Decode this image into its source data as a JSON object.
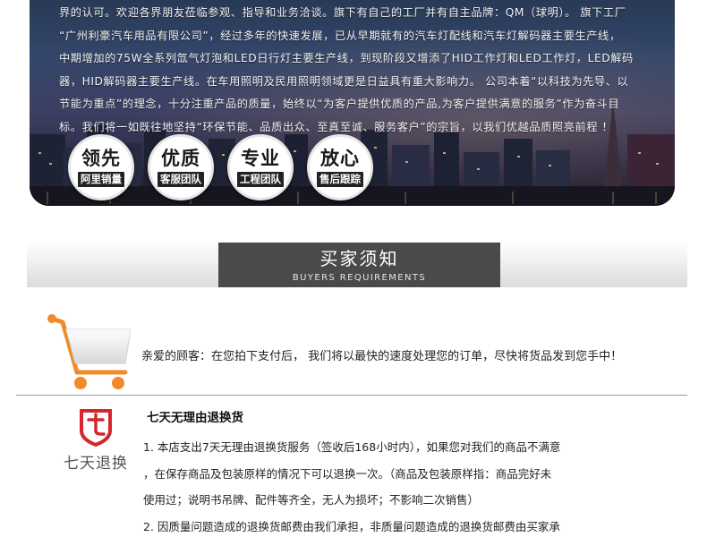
{
  "intro": {
    "lines": [
      "界的认可。欢迎各界朋友莅临参观、指导和业务洽谈。旗下有自己的工厂并有自主品牌：QM（球明）。 旗下工厂",
      "“广州利豪汽车用品有限公司”，经过多年的快速发展，已从早期就有的汽车灯配线和汽车灯解码器主要生产线，",
      "中期增加的75W全系列氙气灯泡和LED日行灯主要生产线，到现阶段又增添了HID工作灯和LED工作灯，LED解码",
      "器，HID解码器主要生产线。在车用照明及民用照明领域更是日益具有重大影响力。 公司本着“以科技为先导、以",
      "节能为重点”的理念，十分注重产品的质量，始终以“为客户提供优质的产品,为客户提供满意的服务”作为奋斗目",
      "标。我们将一如既往地坚持“环保节能、品质出众、至真至诚、服务客户”的宗旨，以我们优越品质照亮前程 ！"
    ],
    "badges": [
      {
        "top": "领先",
        "sub": "阿里销量"
      },
      {
        "top": "优质",
        "sub": "客服团队"
      },
      {
        "top": "专业",
        "sub": "工程团队"
      },
      {
        "top": "放心",
        "sub": "售后跟踪"
      }
    ]
  },
  "requirements": {
    "title": "买家须知",
    "subtitle": "BUYERS REQUIREMENTS"
  },
  "cart_notice": {
    "text": "亲爱的顾客：在您拍下支付后， 我们将以最快的速度处理您的订单，尽快将货品发到您手中！",
    "icon": "shopping-cart-icon"
  },
  "returns": {
    "logo_label": "七天退换",
    "logo_icon": "seven-day-return-shield-icon",
    "title": "七天无理由退换货",
    "lines": [
      "1. 本店支出7天无理由退换货服务（签收后168小时内），如果您对我们的商品不满意",
      "，在保存商品及包装原样的情况下可以退换一次。（商品及包装原样指：商品完好未",
      "使用过；说明书吊牌、配件等齐全，无人为损坏；不影响二次销售）",
      "2. 因质量问题造成的退换货邮费由我们承担，非质量问题造成的退换货邮费由买家承"
    ]
  },
  "colors": {
    "accent_orange": "#f08a2a",
    "brand_red": "#d6262c",
    "header_gray": "#4a4a4a"
  }
}
